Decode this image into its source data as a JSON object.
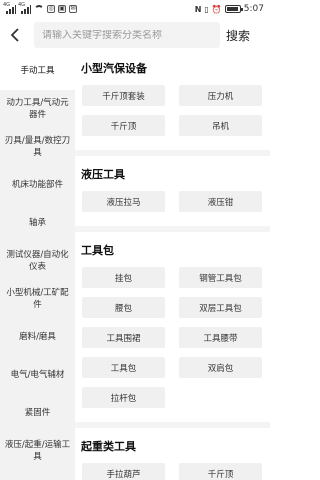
{
  "status": {
    "signal1": "4G",
    "signal2": "4G",
    "time": "5:07"
  },
  "topbar": {
    "back_icon": "back-arrow-icon",
    "search_placeholder": "请输入关键字搜索分类名称",
    "search_label": "搜索"
  },
  "sidebar": {
    "items": [
      {
        "label": "手动工具"
      },
      {
        "label": "动力工具/气动元器件"
      },
      {
        "label": "刃具/量具/数控刀具"
      },
      {
        "label": "机床功能部件"
      },
      {
        "label": "轴承"
      },
      {
        "label": "测试仪器/自动化仪表"
      },
      {
        "label": "小型机械/工矿配件"
      },
      {
        "label": "磨料/磨具"
      },
      {
        "label": "电气/电气辅材"
      },
      {
        "label": "紧固件"
      },
      {
        "label": "液压/起重/运输工具"
      }
    ]
  },
  "sections": [
    {
      "title": "小型汽保设备",
      "items": [
        "千斤顶套装",
        "压力机",
        "千斤顶",
        "吊机"
      ]
    },
    {
      "title": "液压工具",
      "items": [
        "液压拉马",
        "液压钳"
      ]
    },
    {
      "title": "工具包",
      "items": [
        "挂包",
        "钢管工具包",
        "腰包",
        "双层工具包",
        "工具围裙",
        "工具腰带",
        "工具包",
        "双肩包",
        "拉杆包"
      ]
    },
    {
      "title": "起重类工具",
      "items": [
        "手拉葫芦",
        "千斤顶"
      ]
    }
  ]
}
